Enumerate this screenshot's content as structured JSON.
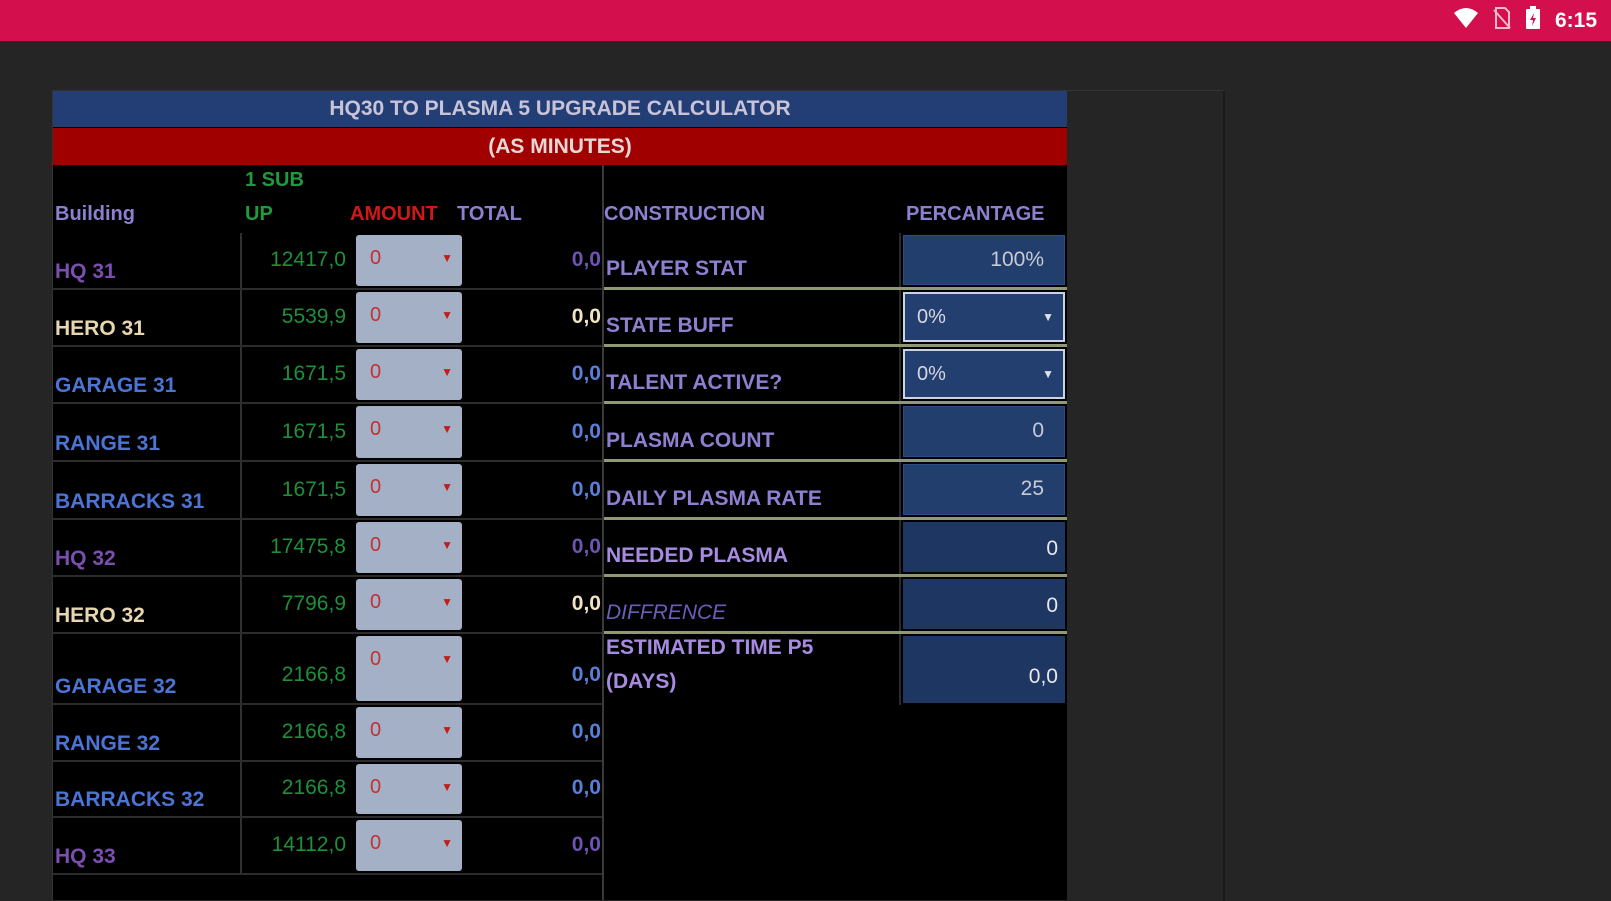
{
  "status_bar": {
    "time": "6:15",
    "icons": [
      "wifi-icon",
      "no-sim-icon",
      "battery-icon"
    ],
    "color": "#d40f4e"
  },
  "sheet": {
    "title": "HQ30 TO PLASMA 5 UPGRADE CALCULATOR",
    "subtitle": "(AS MINUTES)",
    "title_color": "#233e75",
    "subtitle_color": "#a00000"
  },
  "headers": {
    "building": "Building",
    "sub_up_line1": "1 SUB",
    "sub_up_line2": "UP",
    "amount": "AMOUNT",
    "total": "TOTAL",
    "construction": "CONSTRUCTION",
    "percentage": "PERCANTAGE"
  },
  "buildings": [
    {
      "name": "HQ 31",
      "value": "12417,0",
      "amount": "0",
      "total": "0,0",
      "color": "#7b4fb0",
      "total_color": "#6f53b2"
    },
    {
      "name": "HERO 31",
      "value": "5539,9",
      "amount": "0",
      "total": "0,0",
      "color": "#e8d7ae",
      "total_color": "#f0e4c4"
    },
    {
      "name": "GARAGE 31",
      "value": "1671,5",
      "amount": "0",
      "total": "0,0",
      "color": "#4c74d4",
      "total_color": "#5a7ed8"
    },
    {
      "name": "RANGE 31",
      "value": "1671,5",
      "amount": "0",
      "total": "0,0",
      "color": "#4c74d4",
      "total_color": "#5a7ed8"
    },
    {
      "name": "BARRACKS 31",
      "value": "1671,5",
      "amount": "0",
      "total": "0,0",
      "color": "#4c74d4",
      "total_color": "#5a7ed8"
    },
    {
      "name": "HQ 32",
      "value": "17475,8",
      "amount": "0",
      "total": "0,0",
      "color": "#7b4fb0",
      "total_color": "#6f53b2"
    },
    {
      "name": "HERO 32",
      "value": "7796,9",
      "amount": "0",
      "total": "0,0",
      "color": "#e8d7ae",
      "total_color": "#f0e4c4"
    },
    {
      "name": "GARAGE 32",
      "value": "2166,8",
      "amount": "0",
      "total": "0,0",
      "color": "#4c74d4",
      "total_color": "#5a7ed8"
    },
    {
      "name": "RANGE 32",
      "value": "2166,8",
      "amount": "0",
      "total": "0,0",
      "color": "#4c74d4",
      "total_color": "#5a7ed8"
    },
    {
      "name": "BARRACKS 32",
      "value": "2166,8",
      "amount": "0",
      "total": "0,0",
      "color": "#4c74d4",
      "total_color": "#5a7ed8"
    },
    {
      "name": "HQ 33",
      "value": "14112,0",
      "amount": "0",
      "total": "0,0",
      "color": "#7b4fb0",
      "total_color": "#6f53b2"
    }
  ],
  "construction": {
    "player_stat": {
      "label": "PLAYER STAT",
      "value": "100%"
    },
    "state_buff": {
      "label": "STATE BUFF",
      "value": "0%"
    },
    "talent_active": {
      "label": "TALENT ACTIVE?",
      "value": "0%"
    },
    "plasma_count": {
      "label": "PLASMA COUNT",
      "value": "0"
    },
    "daily_plasma_rate": {
      "label": "DAILY PLASMA RATE",
      "value": "25"
    },
    "needed_plasma": {
      "label": "NEEDED PLASMA",
      "value": "0"
    },
    "diffrence": {
      "label": "DIFFRENCE",
      "value": "0"
    },
    "estimated_time": {
      "label_line1": "ESTIMATED TIME P5",
      "label_line2": "(DAYS)",
      "value": "0,0"
    }
  },
  "colors": {
    "header_purple": "#8f7fd0",
    "header_green": "#1f9a3f",
    "header_red": "#d01818",
    "value_green": "#1f8f3a"
  }
}
